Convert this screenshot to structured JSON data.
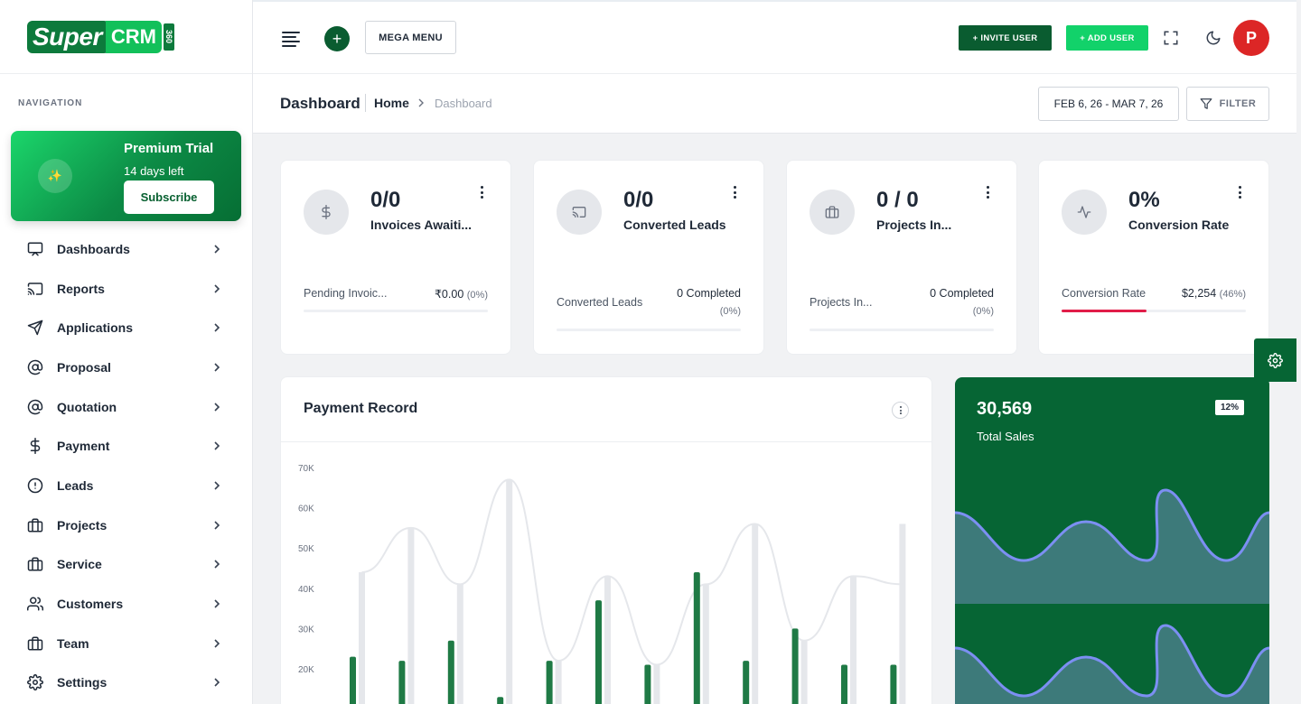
{
  "brand": {
    "word1": "Super",
    "word2": "CRM",
    "badge": "360"
  },
  "sidebar": {
    "heading": "NAVIGATION",
    "trial": {
      "title": "Premium Trial",
      "subtitle": "14 days left",
      "button": "Subscribe"
    },
    "items": [
      {
        "label": "Dashboards",
        "icon": "monitor-icon"
      },
      {
        "label": "Reports",
        "icon": "cast-icon"
      },
      {
        "label": "Applications",
        "icon": "send-icon"
      },
      {
        "label": "Proposal",
        "icon": "at-sign-icon"
      },
      {
        "label": "Quotation",
        "icon": "at-sign-icon"
      },
      {
        "label": "Payment",
        "icon": "dollar-icon"
      },
      {
        "label": "Leads",
        "icon": "alert-circle-icon"
      },
      {
        "label": "Projects",
        "icon": "briefcase-icon"
      },
      {
        "label": "Service",
        "icon": "briefcase-icon"
      },
      {
        "label": "Customers",
        "icon": "users-icon"
      },
      {
        "label": "Team",
        "icon": "briefcase-icon"
      },
      {
        "label": "Settings",
        "icon": "settings-icon"
      }
    ]
  },
  "header": {
    "mega_menu": "MEGA MENU",
    "plus": "+",
    "invite_user": "+ INVITE USER",
    "add_user": "+ ADD USER",
    "avatar_initial": "P"
  },
  "titlebar": {
    "title": "Dashboard",
    "crumb_home": "Home",
    "crumb_current": "Dashboard",
    "date_range": "FEB 6, 26 - MAR 7, 26",
    "filter": "FILTER"
  },
  "cards": [
    {
      "value": "0/0",
      "label": "Invoices Awaiti...",
      "foot_label": "Pending Invoic...",
      "foot_value": "₹0.00",
      "foot_pct": "(0%)",
      "progress": 0,
      "icon": "dollar-icon"
    },
    {
      "value": "0/0",
      "label": "Converted Leads",
      "foot_label": "Converted Leads",
      "foot_value": "0 Completed",
      "foot_pct": "(0%)",
      "progress": 0,
      "icon": "cast-icon"
    },
    {
      "value": "0 / 0",
      "label": "Projects In...",
      "foot_label": "Projects In...",
      "foot_value": "0 Completed",
      "foot_pct": "(0%)",
      "progress": 0,
      "icon": "briefcase-icon"
    },
    {
      "value": "0%",
      "label": "Conversion Rate",
      "foot_label": "Conversion Rate",
      "foot_value": "$2,254",
      "foot_pct": "(46%)",
      "progress": 0.46,
      "icon": "activity-icon"
    }
  ],
  "payment": {
    "title": "Payment Record",
    "chart_data": {
      "type": "bar",
      "y_ticks": [
        "70K",
        "60K",
        "50K",
        "40K",
        "30K",
        "20K"
      ],
      "ylim": [
        0,
        70000
      ],
      "series": [
        {
          "values": [
            44000,
            55000,
            41000,
            67000,
            22000,
            43000,
            21000,
            41000,
            56000,
            27000,
            43000,
            56000
          ],
          "color": "#e5e7eb"
        },
        {
          "values": [
            23000,
            22000,
            27000,
            13000,
            22000,
            37000,
            21000,
            44000,
            22000,
            30000,
            21000,
            21000
          ],
          "color": "#1f7a45"
        }
      ],
      "line": {
        "values": [
          44000,
          55000,
          41000,
          67000,
          22000,
          43000,
          21000,
          41000,
          56000,
          27000,
          43000,
          41000
        ],
        "color": "#e5e7eb"
      }
    }
  },
  "sales": {
    "value": "30,569",
    "label": "Total Sales",
    "badge": "12%",
    "colors": {
      "fill": "#3d7a7a",
      "line": "#7c8ff2"
    }
  },
  "colors": {
    "brand_dark": "#066534",
    "brand_light": "#12d26a",
    "danger": "#dc2626"
  }
}
